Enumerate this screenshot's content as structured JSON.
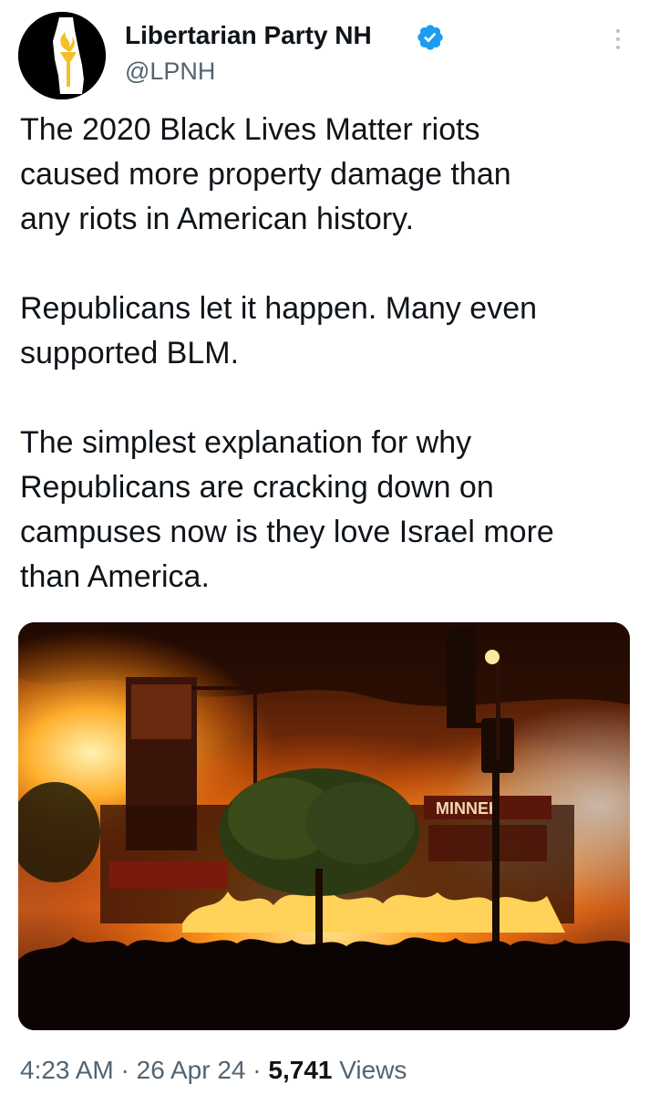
{
  "author": {
    "name": "Libertarian Party NH",
    "handle": "@LPNH",
    "verified": true,
    "avatar_icon": "new-hampshire-torch-logo",
    "avatar_colors": {
      "background": "#000000",
      "state": "#ffffff",
      "torch": "#f2c028"
    }
  },
  "tweet": {
    "paragraphs": [
      [
        "The 2020 Black Lives Matter riots",
        "caused more property damage than",
        "any riots in American history."
      ],
      [
        "Republicans let it happen. Many even",
        "supported BLM."
      ],
      [
        "The simplest explanation for why",
        "Republicans are cracking down on",
        "campuses now is they love Israel more",
        "than America."
      ]
    ]
  },
  "media": {
    "photo_signs": [
      "MINNEH"
    ]
  },
  "meta": {
    "time": "4:23 AM",
    "separator": "·",
    "date": "26 Apr 24",
    "views_count": "5,741",
    "views_label": "Views"
  },
  "icons": {
    "verified": "verified-badge-icon",
    "more": "more-options-icon"
  },
  "colors": {
    "text": "#0f1419",
    "secondary": "#536471",
    "verified_blue": "#1d9bf0"
  }
}
